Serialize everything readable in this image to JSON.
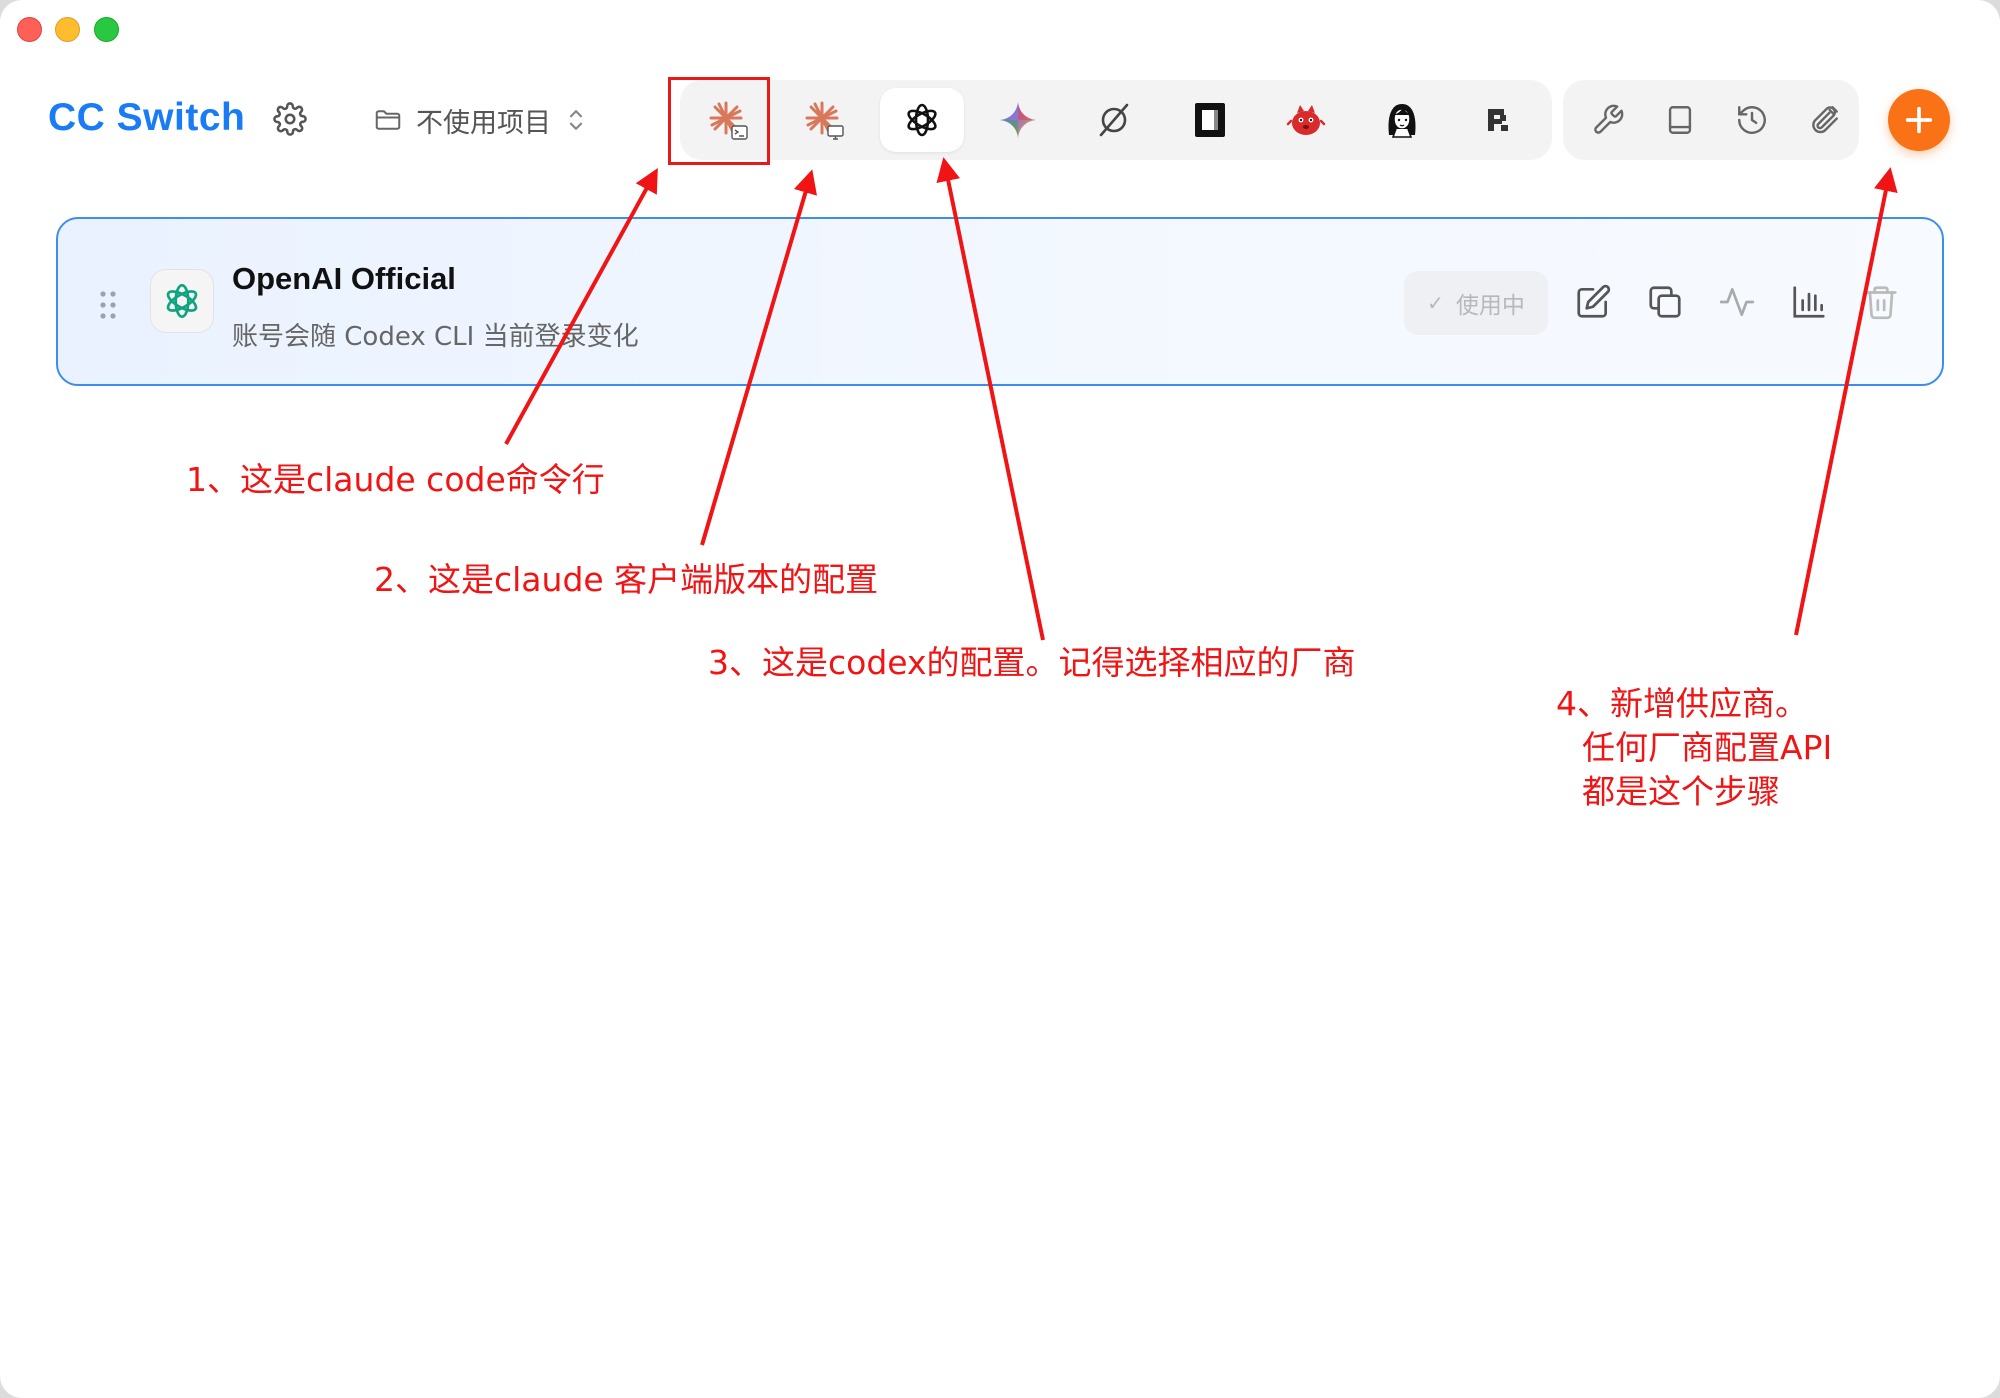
{
  "app": {
    "title": "CC Switch",
    "project_label": "不使用项目"
  },
  "toolbar": {
    "apps": [
      {
        "icon": "claude-code-cli-icon",
        "active": false,
        "highlighted": true
      },
      {
        "icon": "claude-desktop-icon",
        "active": false
      },
      {
        "icon": "openai-codex-icon",
        "active": true
      },
      {
        "icon": "gemini-icon",
        "active": false
      },
      {
        "icon": "opencode-icon",
        "active": false
      },
      {
        "icon": "terminal-app-icon",
        "active": false
      },
      {
        "icon": "red-mascot-icon",
        "active": false
      },
      {
        "icon": "avatar-girl-icon",
        "active": false
      },
      {
        "icon": "pixel-p-icon",
        "active": false
      }
    ],
    "tools": [
      "wrench-icon",
      "book-icon",
      "history-icon",
      "paperclip-icon"
    ],
    "add_icon": "plus-icon",
    "accent": "#f97316"
  },
  "provider": {
    "name": "OpenAI Official",
    "description": "账号会随 Codex CLI 当前登录变化",
    "status": "使用中",
    "border_color": "#3d8cf0"
  },
  "annotations": {
    "a1": "1、这是claude code命令行",
    "a2": "2、这是claude 客户端版本的配置",
    "a3": "3、这是codex的配置。记得选择相应的厂商",
    "a4_line1": "4、新增供应商。",
    "a4_line2": "任何厂商配置API",
    "a4_line3": "都是这个步骤",
    "color": "#f01414"
  }
}
